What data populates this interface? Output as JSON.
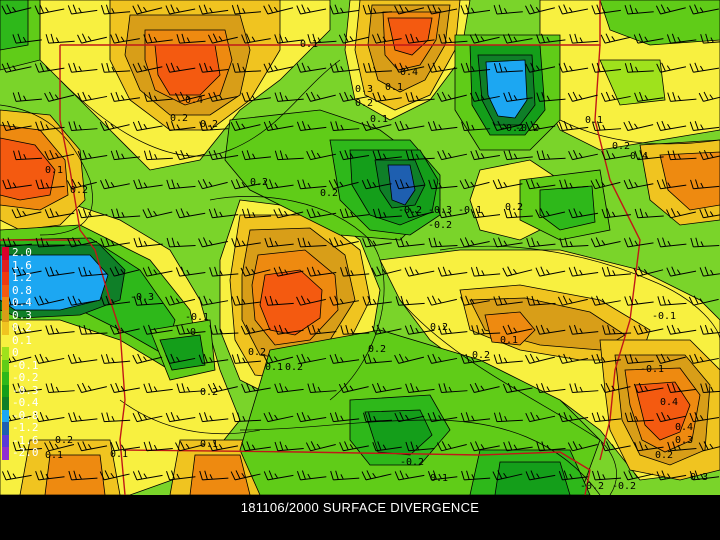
{
  "caption": "181106/2000 SURFACE DIVERGENCE",
  "legend": {
    "levels": [
      {
        "label": "2.0",
        "color": "#d9002a"
      },
      {
        "label": "1.6",
        "color": "#e02020"
      },
      {
        "label": "1.2",
        "color": "#f03a10"
      },
      {
        "label": "0.8",
        "color": "#f45a10"
      },
      {
        "label": "0.4",
        "color": "#ee8a10"
      },
      {
        "label": "0.3",
        "color": "#d89e18"
      },
      {
        "label": "0.2",
        "color": "#f0c420"
      },
      {
        "label": "0.1",
        "color": "#f8f040"
      },
      {
        "label": "0",
        "color": "#9fe21c"
      },
      {
        "label": "-0.1",
        "color": "#60cc18"
      },
      {
        "label": "-0.2",
        "color": "#2eb81a"
      },
      {
        "label": "-0.3",
        "color": "#149e1a"
      },
      {
        "label": "-0.4",
        "color": "#0f7f28"
      },
      {
        "label": "-0.8",
        "color": "#1ca7f2"
      },
      {
        "label": "-1.2",
        "color": "#1e5fb0"
      },
      {
        "label": "-1.6",
        "color": "#5a3ad8"
      },
      {
        "label": "-2.0",
        "color": "#9030d0"
      }
    ]
  },
  "contour_labels": [
    "0.1",
    "0.4",
    "0.4",
    "0.2",
    "0.2",
    "0.3",
    "0.1",
    "0.2",
    "0.1",
    "0.1",
    "0.2",
    "0.2",
    "-0.2",
    "0.1",
    "0.2",
    "0.4",
    "0.2",
    "-0.3",
    "-0.1",
    "-0.2",
    "0.2",
    "-0.3",
    "-0.1",
    "0",
    "0.2",
    "0.1",
    "0.2",
    "0.2",
    "0.1",
    "0.2",
    "-0.1",
    "0.1",
    "-0.2",
    "0.4",
    "0.3",
    "0.2",
    "0.1",
    "-0.2",
    "0.2",
    "0.1",
    "0.1",
    "0.4",
    "0.3",
    "-0.2",
    "-0.2",
    "-0.2",
    "0.2",
    "-0.1",
    "0.2"
  ],
  "colors": {
    "background": "#6fd12a",
    "contour": "#000000",
    "borders": "#c01818",
    "wind_barbs": "#000000"
  }
}
